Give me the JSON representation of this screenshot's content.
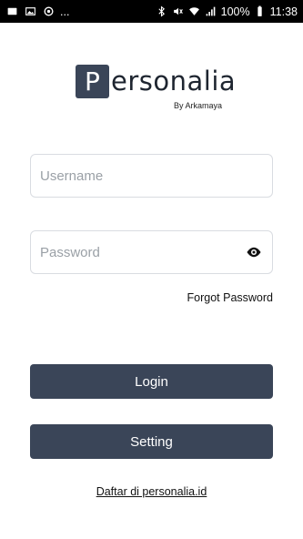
{
  "status_bar": {
    "left_icons": [
      "photo-icon",
      "gallery-icon",
      "sync-icon"
    ],
    "more": "...",
    "right_icons": [
      "bluetooth-icon",
      "mute-icon",
      "wifi-icon",
      "signal-icon"
    ],
    "battery": "100%",
    "battery_icon": "battery-icon",
    "time": "11:38"
  },
  "logo": {
    "letter": "P",
    "word": "ersonalia",
    "byline": "By Arkamaya"
  },
  "form": {
    "username_placeholder": "Username",
    "username_value": "",
    "password_placeholder": "Password",
    "password_value": "",
    "password_toggle_icon": "eye-icon",
    "forgot_password": "Forgot Password"
  },
  "buttons": {
    "login": "Login",
    "setting": "Setting"
  },
  "footer": {
    "register_link": "Daftar di personalia.id"
  },
  "colors": {
    "primary": "#3a4558",
    "status_bar": "#000000",
    "border": "#d9dce1"
  }
}
